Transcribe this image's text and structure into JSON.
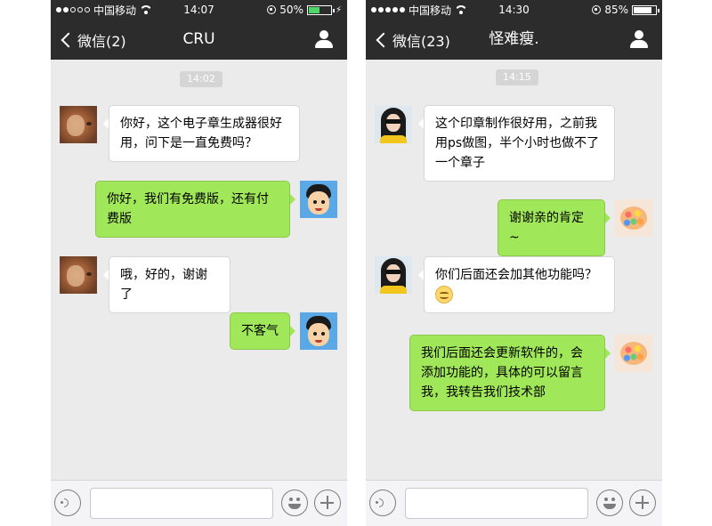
{
  "left_phone": {
    "status": {
      "carrier": "中国移动",
      "time": "14:07",
      "battery": "50%"
    },
    "nav": {
      "back_label": "微信(2)",
      "title": "CRU"
    },
    "timestamp": "14:02",
    "messages": [
      {
        "side": "in",
        "text": "你好，这个电子章生成器很好用，问下是一直免费吗？"
      },
      {
        "side": "out",
        "text": "你好，我们有免费版，还有付费版"
      },
      {
        "side": "in",
        "text": "哦，好的，谢谢了"
      },
      {
        "side": "out",
        "text": "不客气"
      }
    ]
  },
  "right_phone": {
    "status": {
      "carrier": "中国移动",
      "time": "14:30",
      "battery": "85%"
    },
    "nav": {
      "back_label": "微信(23)",
      "title": "怪难瘦."
    },
    "timestamp": "14:15",
    "messages": [
      {
        "side": "in",
        "text": "这个印章制作很好用，之前我用ps做图，半个小时也做不了一个章子"
      },
      {
        "side": "out",
        "text": "谢谢亲的肯定~"
      },
      {
        "side": "in",
        "text": "你们后面还会加其他功能吗？"
      },
      {
        "side": "out",
        "text": "我们后面还会更新软件的，会添加功能的，具体的可以留言我，我转告我们技术部"
      }
    ]
  },
  "colors": {
    "bar_dark": "#2c2c2c",
    "chat_bg": "#ebebeb",
    "bubble_out": "#a0e75a",
    "bubble_in": "#ffffff",
    "battery_green": "#4cd964"
  }
}
